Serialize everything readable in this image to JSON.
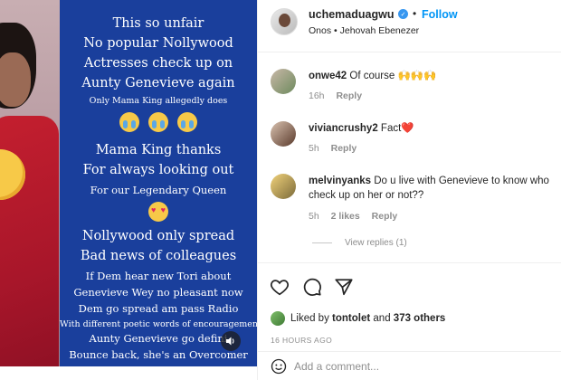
{
  "media": {
    "lines": [
      "This so unfair",
      "No popular Nollywood",
      "Actresses check up on",
      "Aunty Genevieve again",
      "Only Mama King allegedly does",
      "Mama King thanks",
      "For always looking out",
      "For our Legendary Queen",
      "Nollywood only spread",
      "Bad news of colleagues",
      "If Dem hear new Tori about",
      "Genevieve Wey no pleasant now",
      "Dem go spread am pass Radio",
      "With different poetic words of encouragement",
      "Aunty Genevieve go defini",
      "Bounce back, she's an Overcomer"
    ],
    "emoji_crying": "loudly-crying-face-emoji",
    "emoji_heart_eyes": "heart-eyes-emoji",
    "audio_icon": "speaker-icon"
  },
  "header": {
    "username": "uchemaduagwu",
    "verified_icon": "verified-badge-icon",
    "separator": "•",
    "follow_label": "Follow",
    "subtitle": "Onos • Jehovah Ebenezer",
    "accent_color": "#0095f6"
  },
  "comments": [
    {
      "user": "onwe42",
      "text": "Of course 🙌🙌🙌",
      "time": "16h",
      "likes": "",
      "reply": "Reply"
    },
    {
      "user": "viviancrushy2",
      "text": "Fact❤️",
      "time": "5h",
      "likes": "",
      "reply": "Reply"
    },
    {
      "user": "melvinyanks",
      "text": "Do u live with Genevieve to know who check up on her or not??",
      "time": "5h",
      "likes": "2 likes",
      "reply": "Reply"
    }
  ],
  "view_replies": "View replies (1)",
  "actions": {
    "like_icon": "heart-outline-icon",
    "comment_icon": "comment-bubble-icon",
    "share_icon": "paper-plane-icon"
  },
  "liked_by": {
    "prefix": "Liked by",
    "user": "tontolet",
    "middle": "and",
    "others": "373 others"
  },
  "timestamp": "16 HOURS AGO",
  "add_comment": {
    "placeholder": "Add a comment...",
    "emoji_icon": "smiley-icon"
  }
}
